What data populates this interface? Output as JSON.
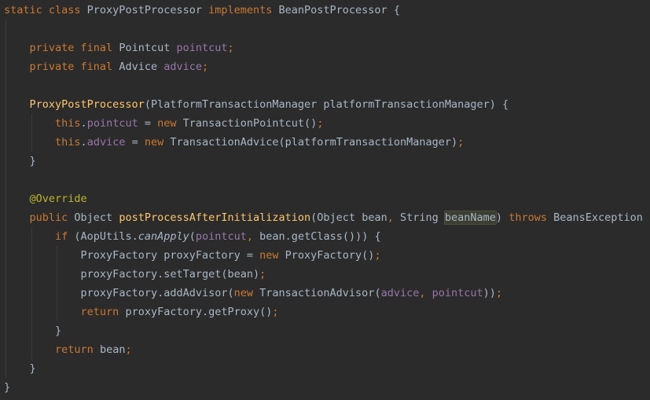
{
  "editor": {
    "language": "java",
    "highlighted_token": "beanName",
    "colors": {
      "background": "#2b2b2b",
      "plain": "#a9b7c6",
      "keyword": "#cc7832",
      "field": "#9876aa",
      "method_declaration": "#ffc66d",
      "annotation": "#bbb529",
      "usage_highlight": "#3b3e31"
    },
    "lines": [
      [
        {
          "t": "static class ",
          "c": "kw"
        },
        {
          "t": "ProxyPostProcessor "
        },
        {
          "t": "implements ",
          "c": "kw"
        },
        {
          "t": "BeanPostProcessor {"
        }
      ],
      [],
      [
        {
          "t": "    "
        },
        {
          "t": "private final ",
          "c": "kw"
        },
        {
          "t": "Pointcut "
        },
        {
          "t": "pointcut",
          "c": "fld"
        },
        {
          "t": ";",
          "c": "kw"
        }
      ],
      [
        {
          "t": "    "
        },
        {
          "t": "private final ",
          "c": "kw"
        },
        {
          "t": "Advice "
        },
        {
          "t": "advice",
          "c": "fld"
        },
        {
          "t": ";",
          "c": "kw"
        }
      ],
      [],
      [
        {
          "t": "    "
        },
        {
          "t": "ProxyPostProcessor",
          "c": "fn"
        },
        {
          "t": "(PlatformTransactionManager platformTransactionManager) {"
        }
      ],
      [
        {
          "t": "        "
        },
        {
          "t": "this",
          "c": "kw"
        },
        {
          "t": "."
        },
        {
          "t": "pointcut",
          "c": "fld"
        },
        {
          "t": " = "
        },
        {
          "t": "new ",
          "c": "kw"
        },
        {
          "t": "TransactionPointcut()"
        },
        {
          "t": ";",
          "c": "kw"
        }
      ],
      [
        {
          "t": "        "
        },
        {
          "t": "this",
          "c": "kw"
        },
        {
          "t": "."
        },
        {
          "t": "advice",
          "c": "fld"
        },
        {
          "t": " = "
        },
        {
          "t": "new ",
          "c": "kw"
        },
        {
          "t": "TransactionAdvice(platformTransactionManager)"
        },
        {
          "t": ";",
          "c": "kw"
        }
      ],
      [
        {
          "t": "    }"
        }
      ],
      [],
      [
        {
          "t": "    "
        },
        {
          "t": "@Override",
          "c": "ann"
        }
      ],
      [
        {
          "t": "    "
        },
        {
          "t": "public ",
          "c": "kw"
        },
        {
          "t": "Object "
        },
        {
          "t": "postProcessAfterInitialization",
          "c": "fn"
        },
        {
          "t": "(Object bean"
        },
        {
          "t": ", ",
          "c": "kw"
        },
        {
          "t": "String "
        },
        {
          "t": "beanName",
          "c": "hl"
        },
        {
          "t": ") "
        },
        {
          "t": "throws ",
          "c": "kw"
        },
        {
          "t": "BeansException {"
        }
      ],
      [
        {
          "t": "        "
        },
        {
          "t": "if ",
          "c": "kw"
        },
        {
          "t": "(AopUtils."
        },
        {
          "t": "canApply",
          "c": "it"
        },
        {
          "t": "("
        },
        {
          "t": "pointcut",
          "c": "fld"
        },
        {
          "t": ", ",
          "c": "kw"
        },
        {
          "t": "bean.getClass())) {"
        }
      ],
      [
        {
          "t": "            "
        },
        {
          "t": "ProxyFactory proxyFactory = "
        },
        {
          "t": "new ",
          "c": "kw"
        },
        {
          "t": "ProxyFactory()"
        },
        {
          "t": ";",
          "c": "kw"
        }
      ],
      [
        {
          "t": "            "
        },
        {
          "t": "proxyFactory.setTarget(bean)"
        },
        {
          "t": ";",
          "c": "kw"
        }
      ],
      [
        {
          "t": "            "
        },
        {
          "t": "proxyFactory.addAdvisor("
        },
        {
          "t": "new ",
          "c": "kw"
        },
        {
          "t": "TransactionAdvisor("
        },
        {
          "t": "advice",
          "c": "fld"
        },
        {
          "t": ", ",
          "c": "kw"
        },
        {
          "t": "pointcut",
          "c": "fld"
        },
        {
          "t": "))"
        },
        {
          "t": ";",
          "c": "kw"
        }
      ],
      [
        {
          "t": "            "
        },
        {
          "t": "return ",
          "c": "kw"
        },
        {
          "t": "proxyFactory.getProxy()"
        },
        {
          "t": ";",
          "c": "kw"
        }
      ],
      [
        {
          "t": "        }"
        }
      ],
      [
        {
          "t": "        "
        },
        {
          "t": "return ",
          "c": "kw"
        },
        {
          "t": "bean"
        },
        {
          "t": ";",
          "c": "kw"
        }
      ],
      [
        {
          "t": "    }"
        }
      ],
      [
        {
          "t": "}"
        }
      ]
    ]
  }
}
